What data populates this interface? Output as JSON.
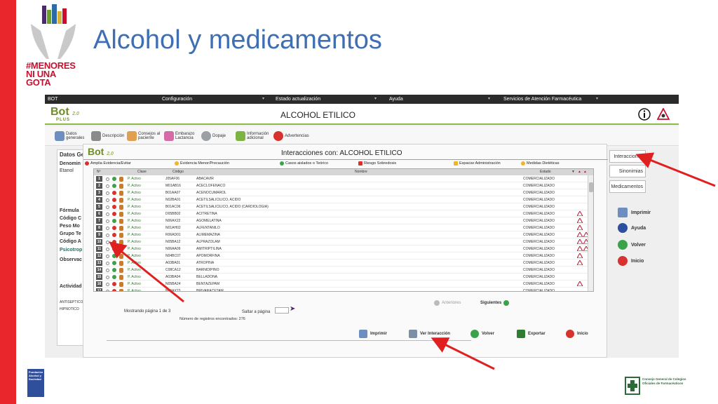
{
  "slide": {
    "title": "Alcohol y medicamentos",
    "campaign_logo_text": [
      "#MENORES",
      "NI UNA",
      "GOTA"
    ],
    "footer_left_logo": "Fundación Alcohol y Sociedad",
    "footer_right_logo": "Consejo General de Colegios Oficiales de Farmacéuticos"
  },
  "menubar": {
    "items": [
      "BOT",
      "Configuración",
      "Estado actualización",
      "Ayuda",
      "Servicios de Atención Farmacéutica"
    ]
  },
  "header": {
    "app_logo": "Bot",
    "app_logo_plus": "PLUS",
    "app_version": "2.0",
    "drug_title": "ALCOHOL ETILICO"
  },
  "toolbar": {
    "items": [
      {
        "label": "Datos generales",
        "icon": "data-icon"
      },
      {
        "label": "Descripción",
        "icon": "book-icon"
      },
      {
        "label": "Consejos al paciente",
        "icon": "person-icon"
      },
      {
        "label": "Embarazo Lactancia",
        "icon": "pregnancy-icon"
      },
      {
        "label": "Dopaje",
        "icon": "sports-icon"
      },
      {
        "label": "Información adicional",
        "icon": "info-icon"
      },
      {
        "label": "Advertencias",
        "icon": "warning-icon"
      }
    ]
  },
  "left_panel": {
    "header": "Datos Ge",
    "denominacion_label": "Denomin",
    "denominacion_value": "Etanol",
    "fields": [
      "Fórmula",
      "Código C",
      "Peso Mo",
      "Grupo Te",
      "Código A",
      "Psicotrop",
      "Observac"
    ],
    "actividad_label": "Actividad",
    "actividad_items": [
      "ANTISEPTICO",
      "HIPNOTICO"
    ]
  },
  "right_panel": {
    "buttons": [
      "Interacciones",
      "Sinonimias",
      "Medicamentos"
    ],
    "actions": [
      {
        "label": "Imprimir",
        "icon": "print-icon"
      },
      {
        "label": "Ayuda",
        "icon": "help-icon"
      },
      {
        "label": "Volver",
        "icon": "back-icon"
      },
      {
        "label": "Inicio",
        "icon": "home-icon"
      }
    ]
  },
  "dialog": {
    "logo": "Bot",
    "logo_version": "2.0",
    "title": "Interacciones con: ALCOHOL ETILICO",
    "legend": [
      {
        "label": "Amplia Evidencia/Evitar",
        "color": "#d8322f"
      },
      {
        "label": "Evidencia Menor/Precaución",
        "color": "#f0b429"
      },
      {
        "label": "Casos aislados o Teórico",
        "color": "#3aa34a"
      },
      {
        "label": "Riesgo Sobredosis",
        "color": "#d8322f"
      },
      {
        "label": "Espaciar Administración",
        "color": "#f0b429"
      },
      {
        "label": "Medidas Dietéticas",
        "color": "#f0b429"
      }
    ],
    "columns": [
      "Nº",
      "Clase",
      "Código",
      "Nombre",
      "Estado"
    ],
    "rows": [
      {
        "n": "1",
        "clase": "P. Activo",
        "codigo": "J05AF06",
        "nombre": "ABACAVIR",
        "estado": "COMERCIALIZADO",
        "level": "green",
        "warn": []
      },
      {
        "n": "2",
        "clase": "P. Activo",
        "codigo": "M01AB16",
        "nombre": "ACECLOFENACO",
        "estado": "COMERCIALIZADO",
        "level": "green",
        "warn": []
      },
      {
        "n": "3",
        "clase": "P. Activo",
        "codigo": "B01AA07",
        "nombre": "ACENOCUMAROL",
        "estado": "COMERCIALIZADO",
        "level": "red",
        "warn": []
      },
      {
        "n": "4",
        "clase": "P. Activo",
        "codigo": "N02BA01",
        "nombre": "ACETILSALICILICO, ACIDO",
        "estado": "COMERCIALIZADO",
        "level": "red",
        "warn": []
      },
      {
        "n": "5",
        "clase": "P. Activo",
        "codigo": "B01AC06",
        "nombre": "ACETILSALICILICO, ACIDO (CARDIOLOGIA)",
        "estado": "COMERCIALIZADO",
        "level": "red",
        "warn": []
      },
      {
        "n": "6",
        "clase": "P. Activo",
        "codigo": "D05BB02",
        "nombre": "ACITRETINA",
        "estado": "COMERCIALIZADO",
        "level": "red",
        "warn": [
          "a"
        ]
      },
      {
        "n": "7",
        "clase": "P. Activo",
        "codigo": "N06AX22",
        "nombre": "AGOMELATINA",
        "estado": "COMERCIALIZADO",
        "level": "green",
        "warn": [
          "a"
        ]
      },
      {
        "n": "8",
        "clase": "P. Activo",
        "codigo": "N01AH02",
        "nombre": "ALFENTANILO",
        "estado": "COMERCIALIZADO",
        "level": "red",
        "warn": [
          "a"
        ]
      },
      {
        "n": "9",
        "clase": "P. Activo",
        "codigo": "R06AD01",
        "nombre": "ALIMEMAZINA",
        "estado": "COMERCIALIZADO",
        "level": "red",
        "warn": [
          "a",
          "b"
        ]
      },
      {
        "n": "10",
        "clase": "P. Activo",
        "codigo": "N05BA12",
        "nombre": "ALPRAZOLAM",
        "estado": "COMERCIALIZADO",
        "level": "red",
        "warn": [
          "a",
          "b"
        ]
      },
      {
        "n": "11",
        "clase": "P. Activo",
        "codigo": "N06AA09",
        "nombre": "AMITRIPTILINA",
        "estado": "COMERCIALIZADO",
        "level": "red",
        "warn": [
          "a",
          "b"
        ]
      },
      {
        "n": "12",
        "clase": "P. Activo",
        "codigo": "N04BC07",
        "nombre": "APOMORFINA",
        "estado": "COMERCIALIZADO",
        "level": "green",
        "warn": [
          "a"
        ]
      },
      {
        "n": "13",
        "clase": "P. Activo",
        "codigo": "A03BA01",
        "nombre": "ATROPINA",
        "estado": "COMERCIALIZADO",
        "level": "green",
        "warn": [
          "a"
        ]
      },
      {
        "n": "14",
        "clase": "P. Activo",
        "codigo": "C08CA12",
        "nombre": "BARNIDIPINO",
        "estado": "COMERCIALIZADO",
        "level": "green",
        "warn": []
      },
      {
        "n": "15",
        "clase": "P. Activo",
        "codigo": "A03BA04",
        "nombre": "BELLADONA",
        "estado": "COMERCIALIZADO",
        "level": "green",
        "warn": []
      },
      {
        "n": "16",
        "clase": "P. Activo",
        "codigo": "N05BA24",
        "nombre": "BENTAZEPAM",
        "estado": "COMERCIALIZADO",
        "level": "red",
        "warn": [
          "a"
        ]
      },
      {
        "n": "17",
        "clase": "P. Activo",
        "codigo": "N03AX23",
        "nombre": "BRIVARACETAM",
        "estado": "COMERCIALIZADO",
        "level": "red",
        "warn": []
      }
    ],
    "pager": {
      "prev_label": "Anteriores",
      "next_label": "Siguientes",
      "page_info": "Mostrando página 1 de 3",
      "jump_label": "Saltar a página",
      "records_label": "Número de registros encontrados: 276"
    },
    "actions": [
      {
        "label": "Imprimir",
        "icon": "print-icon"
      },
      {
        "label": "Ver Interacción",
        "icon": "view-icon"
      },
      {
        "label": "Volver",
        "icon": "back-icon"
      },
      {
        "label": "Exportar",
        "icon": "excel-icon"
      },
      {
        "label": "Inicio",
        "icon": "home-icon"
      }
    ]
  },
  "colors": {
    "red_bar": "#e8262b",
    "title_blue": "#3f6fb2",
    "accent_green": "#8dba42",
    "arrow_red": "#e02020"
  }
}
